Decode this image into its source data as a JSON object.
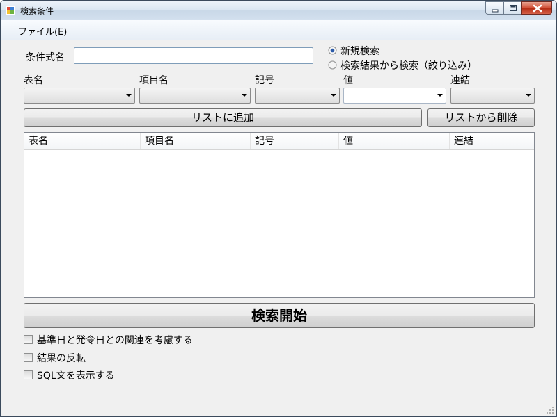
{
  "window": {
    "title": "検索条件"
  },
  "menu": {
    "file": "ファイル(E)"
  },
  "condition": {
    "label": "条件式名",
    "value": ""
  },
  "mode": {
    "options": [
      {
        "label": "新規検索",
        "selected": true
      },
      {
        "label": "検索結果から検索（絞り込み）",
        "selected": false
      }
    ]
  },
  "fields": {
    "table_label": "表名",
    "item_label": "項目名",
    "symbol_label": "記号",
    "value_label": "値",
    "link_label": "連結"
  },
  "buttons": {
    "add": "リストに追加",
    "remove": "リストから削除",
    "search": "検索開始"
  },
  "list": {
    "columns": [
      "表名",
      "項目名",
      "記号",
      "値",
      "連結"
    ],
    "rows": []
  },
  "options": {
    "opt1": {
      "label": "基準日と発令日との関連を考慮する",
      "checked": false
    },
    "opt2": {
      "label": "結果の反転",
      "checked": false
    },
    "opt3": {
      "label": "SQL文を表示する",
      "checked": false
    }
  }
}
